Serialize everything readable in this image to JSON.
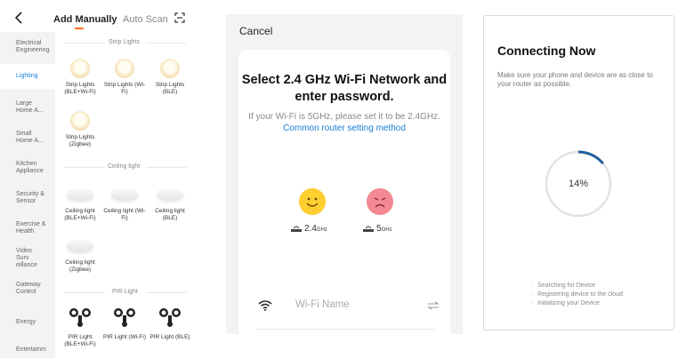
{
  "panel_add": {
    "tabs": {
      "manual": "Add Manually",
      "auto": "Auto Scan"
    },
    "categories": [
      "Electrical Engineering",
      "Lighting",
      "Large Home A...",
      "Small Home A...",
      "Kitchen Appliance",
      "Security & Sensor",
      "Exercise & Health",
      "Video Surv eillance",
      "Gateway Control",
      "Energy",
      "Entertainm"
    ],
    "sections": {
      "strip": "Strip Lights",
      "ceiling": "Ceiling light",
      "pir": "PIR Light"
    },
    "devices": {
      "strip": [
        "Strip Lights (BLE+Wi-Fi)",
        "Strip Lights (Wi-Fi)",
        "Strip Lights (BLE)",
        "Strip Lights (Zigbee)"
      ],
      "ceiling": [
        "Ceiling light (BLE+Wi-Fi)",
        "Ceiling light (Wi-Fi)",
        "Ceiling light (BLE)",
        "Ceiling light (Zigbee)"
      ],
      "pir": [
        "PIR Light (BLE+Wi-Fi)",
        "PIR Light (Wi-Fi)",
        "PIR Light (BLE)"
      ]
    },
    "colors": {
      "accent": "#ff6a00",
      "active": "#1a82d6"
    }
  },
  "panel_wifi": {
    "cancel": "Cancel",
    "title": "Select 2.4 GHz Wi-Fi Network and enter password.",
    "subtitle": "If your Wi-Fi is 5GHz, please set it to be 2.4GHz.",
    "link": "Common router setting method",
    "band_24": {
      "value": "2.4",
      "unit": "GHz"
    },
    "band_5": {
      "value": "5",
      "unit": "GHz"
    },
    "wifi_placeholder": "Wi-Fi Name"
  },
  "panel_connect": {
    "title": "Connecting Now",
    "subtitle": "Make sure your phone and device are as close to your router as possible.",
    "progress_percent": 14,
    "progress_label": "14%",
    "steps": [
      "Searching for Device",
      "Registering device to the cloud",
      "Initializing your Device"
    ],
    "colors": {
      "ring": "#e3e3e3",
      "progress": "#1f5f9e"
    }
  }
}
